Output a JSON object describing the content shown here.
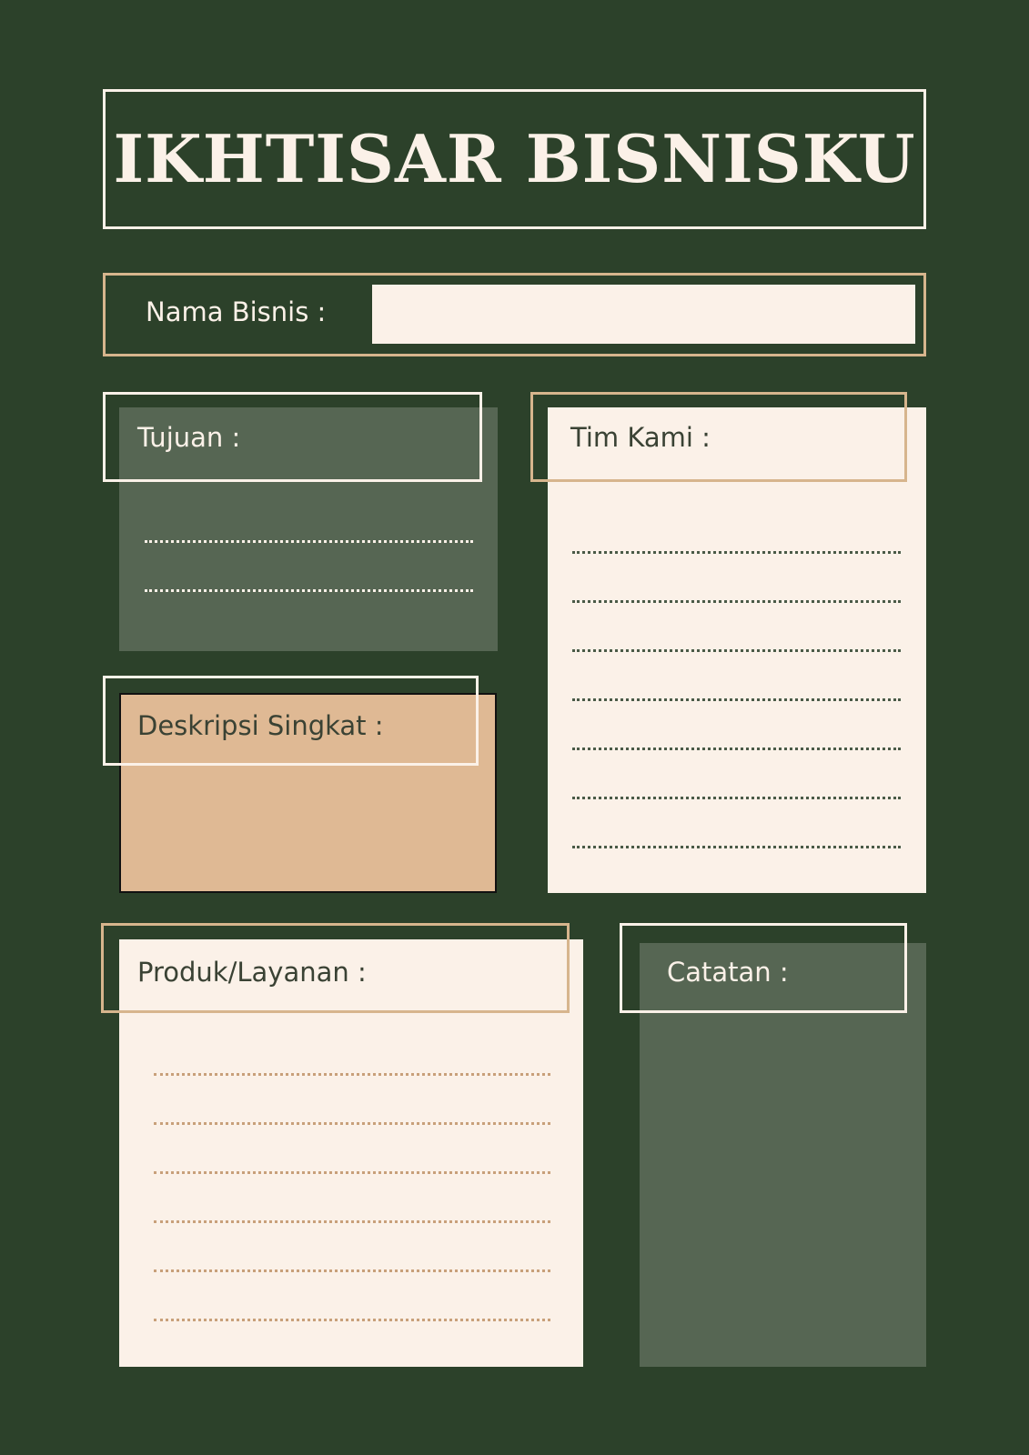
{
  "title": "IKHTISAR BISNISKU",
  "business_name": {
    "label": "Nama Bisnis :",
    "value": ""
  },
  "sections": {
    "goals": {
      "label": "Tujuan :",
      "lines": 2
    },
    "team": {
      "label": "Tim Kami :",
      "lines": 7
    },
    "short_description": {
      "label": "Deskripsi Singkat :"
    },
    "products": {
      "label": "Produk/Layanan :",
      "lines": 6
    },
    "notes": {
      "label": "Catatan :"
    }
  },
  "colors": {
    "background": "#2c412a",
    "cream": "#fbf1e8",
    "tan": "#dfb994",
    "tan_border": "#d7b58d",
    "sage": "#566653"
  }
}
